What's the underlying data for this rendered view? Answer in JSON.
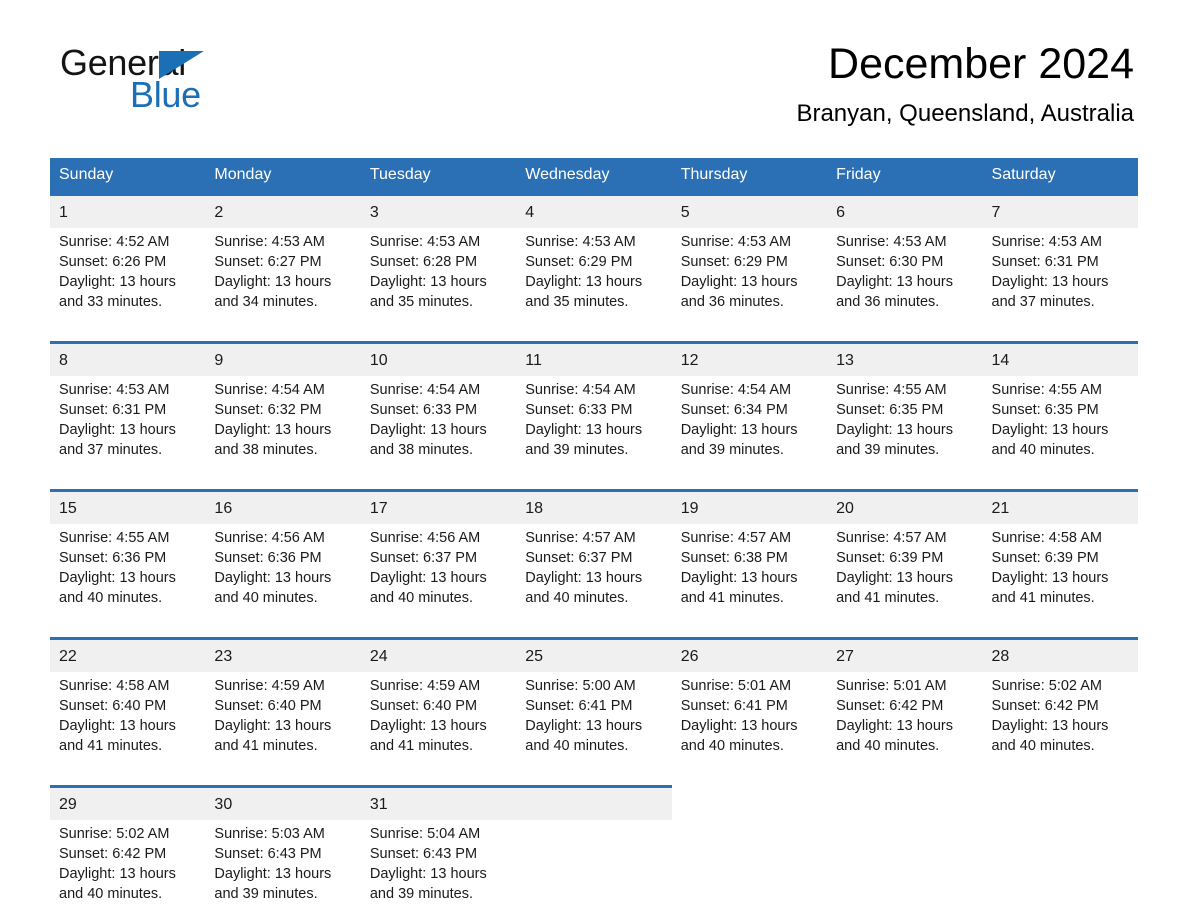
{
  "brand": {
    "name_part1": "General",
    "name_part2": "Blue",
    "flag_icon": "triangle-flag-icon"
  },
  "header": {
    "month_title": "December 2024",
    "location": "Branyan, Queensland, Australia"
  },
  "colors": {
    "header_blue": "#2b70b5",
    "brand_blue": "#1b6fb5",
    "daynum_band": "#f0f0f0",
    "page_background": "#ffffff"
  },
  "weekday_headers": [
    "Sunday",
    "Monday",
    "Tuesday",
    "Wednesday",
    "Thursday",
    "Friday",
    "Saturday"
  ],
  "weeks": [
    {
      "days": [
        {
          "date": "1",
          "sunrise": "Sunrise: 4:52 AM",
          "sunset": "Sunset: 6:26 PM",
          "daylight_line1": "Daylight: 13 hours",
          "daylight_line2": "and 33 minutes."
        },
        {
          "date": "2",
          "sunrise": "Sunrise: 4:53 AM",
          "sunset": "Sunset: 6:27 PM",
          "daylight_line1": "Daylight: 13 hours",
          "daylight_line2": "and 34 minutes."
        },
        {
          "date": "3",
          "sunrise": "Sunrise: 4:53 AM",
          "sunset": "Sunset: 6:28 PM",
          "daylight_line1": "Daylight: 13 hours",
          "daylight_line2": "and 35 minutes."
        },
        {
          "date": "4",
          "sunrise": "Sunrise: 4:53 AM",
          "sunset": "Sunset: 6:29 PM",
          "daylight_line1": "Daylight: 13 hours",
          "daylight_line2": "and 35 minutes."
        },
        {
          "date": "5",
          "sunrise": "Sunrise: 4:53 AM",
          "sunset": "Sunset: 6:29 PM",
          "daylight_line1": "Daylight: 13 hours",
          "daylight_line2": "and 36 minutes."
        },
        {
          "date": "6",
          "sunrise": "Sunrise: 4:53 AM",
          "sunset": "Sunset: 6:30 PM",
          "daylight_line1": "Daylight: 13 hours",
          "daylight_line2": "and 36 minutes."
        },
        {
          "date": "7",
          "sunrise": "Sunrise: 4:53 AM",
          "sunset": "Sunset: 6:31 PM",
          "daylight_line1": "Daylight: 13 hours",
          "daylight_line2": "and 37 minutes."
        }
      ]
    },
    {
      "days": [
        {
          "date": "8",
          "sunrise": "Sunrise: 4:53 AM",
          "sunset": "Sunset: 6:31 PM",
          "daylight_line1": "Daylight: 13 hours",
          "daylight_line2": "and 37 minutes."
        },
        {
          "date": "9",
          "sunrise": "Sunrise: 4:54 AM",
          "sunset": "Sunset: 6:32 PM",
          "daylight_line1": "Daylight: 13 hours",
          "daylight_line2": "and 38 minutes."
        },
        {
          "date": "10",
          "sunrise": "Sunrise: 4:54 AM",
          "sunset": "Sunset: 6:33 PM",
          "daylight_line1": "Daylight: 13 hours",
          "daylight_line2": "and 38 minutes."
        },
        {
          "date": "11",
          "sunrise": "Sunrise: 4:54 AM",
          "sunset": "Sunset: 6:33 PM",
          "daylight_line1": "Daylight: 13 hours",
          "daylight_line2": "and 39 minutes."
        },
        {
          "date": "12",
          "sunrise": "Sunrise: 4:54 AM",
          "sunset": "Sunset: 6:34 PM",
          "daylight_line1": "Daylight: 13 hours",
          "daylight_line2": "and 39 minutes."
        },
        {
          "date": "13",
          "sunrise": "Sunrise: 4:55 AM",
          "sunset": "Sunset: 6:35 PM",
          "daylight_line1": "Daylight: 13 hours",
          "daylight_line2": "and 39 minutes."
        },
        {
          "date": "14",
          "sunrise": "Sunrise: 4:55 AM",
          "sunset": "Sunset: 6:35 PM",
          "daylight_line1": "Daylight: 13 hours",
          "daylight_line2": "and 40 minutes."
        }
      ]
    },
    {
      "days": [
        {
          "date": "15",
          "sunrise": "Sunrise: 4:55 AM",
          "sunset": "Sunset: 6:36 PM",
          "daylight_line1": "Daylight: 13 hours",
          "daylight_line2": "and 40 minutes."
        },
        {
          "date": "16",
          "sunrise": "Sunrise: 4:56 AM",
          "sunset": "Sunset: 6:36 PM",
          "daylight_line1": "Daylight: 13 hours",
          "daylight_line2": "and 40 minutes."
        },
        {
          "date": "17",
          "sunrise": "Sunrise: 4:56 AM",
          "sunset": "Sunset: 6:37 PM",
          "daylight_line1": "Daylight: 13 hours",
          "daylight_line2": "and 40 minutes."
        },
        {
          "date": "18",
          "sunrise": "Sunrise: 4:57 AM",
          "sunset": "Sunset: 6:37 PM",
          "daylight_line1": "Daylight: 13 hours",
          "daylight_line2": "and 40 minutes."
        },
        {
          "date": "19",
          "sunrise": "Sunrise: 4:57 AM",
          "sunset": "Sunset: 6:38 PM",
          "daylight_line1": "Daylight: 13 hours",
          "daylight_line2": "and 41 minutes."
        },
        {
          "date": "20",
          "sunrise": "Sunrise: 4:57 AM",
          "sunset": "Sunset: 6:39 PM",
          "daylight_line1": "Daylight: 13 hours",
          "daylight_line2": "and 41 minutes."
        },
        {
          "date": "21",
          "sunrise": "Sunrise: 4:58 AM",
          "sunset": "Sunset: 6:39 PM",
          "daylight_line1": "Daylight: 13 hours",
          "daylight_line2": "and 41 minutes."
        }
      ]
    },
    {
      "days": [
        {
          "date": "22",
          "sunrise": "Sunrise: 4:58 AM",
          "sunset": "Sunset: 6:40 PM",
          "daylight_line1": "Daylight: 13 hours",
          "daylight_line2": "and 41 minutes."
        },
        {
          "date": "23",
          "sunrise": "Sunrise: 4:59 AM",
          "sunset": "Sunset: 6:40 PM",
          "daylight_line1": "Daylight: 13 hours",
          "daylight_line2": "and 41 minutes."
        },
        {
          "date": "24",
          "sunrise": "Sunrise: 4:59 AM",
          "sunset": "Sunset: 6:40 PM",
          "daylight_line1": "Daylight: 13 hours",
          "daylight_line2": "and 41 minutes."
        },
        {
          "date": "25",
          "sunrise": "Sunrise: 5:00 AM",
          "sunset": "Sunset: 6:41 PM",
          "daylight_line1": "Daylight: 13 hours",
          "daylight_line2": "and 40 minutes."
        },
        {
          "date": "26",
          "sunrise": "Sunrise: 5:01 AM",
          "sunset": "Sunset: 6:41 PM",
          "daylight_line1": "Daylight: 13 hours",
          "daylight_line2": "and 40 minutes."
        },
        {
          "date": "27",
          "sunrise": "Sunrise: 5:01 AM",
          "sunset": "Sunset: 6:42 PM",
          "daylight_line1": "Daylight: 13 hours",
          "daylight_line2": "and 40 minutes."
        },
        {
          "date": "28",
          "sunrise": "Sunrise: 5:02 AM",
          "sunset": "Sunset: 6:42 PM",
          "daylight_line1": "Daylight: 13 hours",
          "daylight_line2": "and 40 minutes."
        }
      ]
    },
    {
      "days": [
        {
          "date": "29",
          "sunrise": "Sunrise: 5:02 AM",
          "sunset": "Sunset: 6:42 PM",
          "daylight_line1": "Daylight: 13 hours",
          "daylight_line2": "and 40 minutes."
        },
        {
          "date": "30",
          "sunrise": "Sunrise: 5:03 AM",
          "sunset": "Sunset: 6:43 PM",
          "daylight_line1": "Daylight: 13 hours",
          "daylight_line2": "and 39 minutes."
        },
        {
          "date": "31",
          "sunrise": "Sunrise: 5:04 AM",
          "sunset": "Sunset: 6:43 PM",
          "daylight_line1": "Daylight: 13 hours",
          "daylight_line2": "and 39 minutes."
        },
        {
          "date": "",
          "sunrise": "",
          "sunset": "",
          "daylight_line1": "",
          "daylight_line2": ""
        },
        {
          "date": "",
          "sunrise": "",
          "sunset": "",
          "daylight_line1": "",
          "daylight_line2": ""
        },
        {
          "date": "",
          "sunrise": "",
          "sunset": "",
          "daylight_line1": "",
          "daylight_line2": ""
        },
        {
          "date": "",
          "sunrise": "",
          "sunset": "",
          "daylight_line1": "",
          "daylight_line2": ""
        }
      ]
    }
  ]
}
